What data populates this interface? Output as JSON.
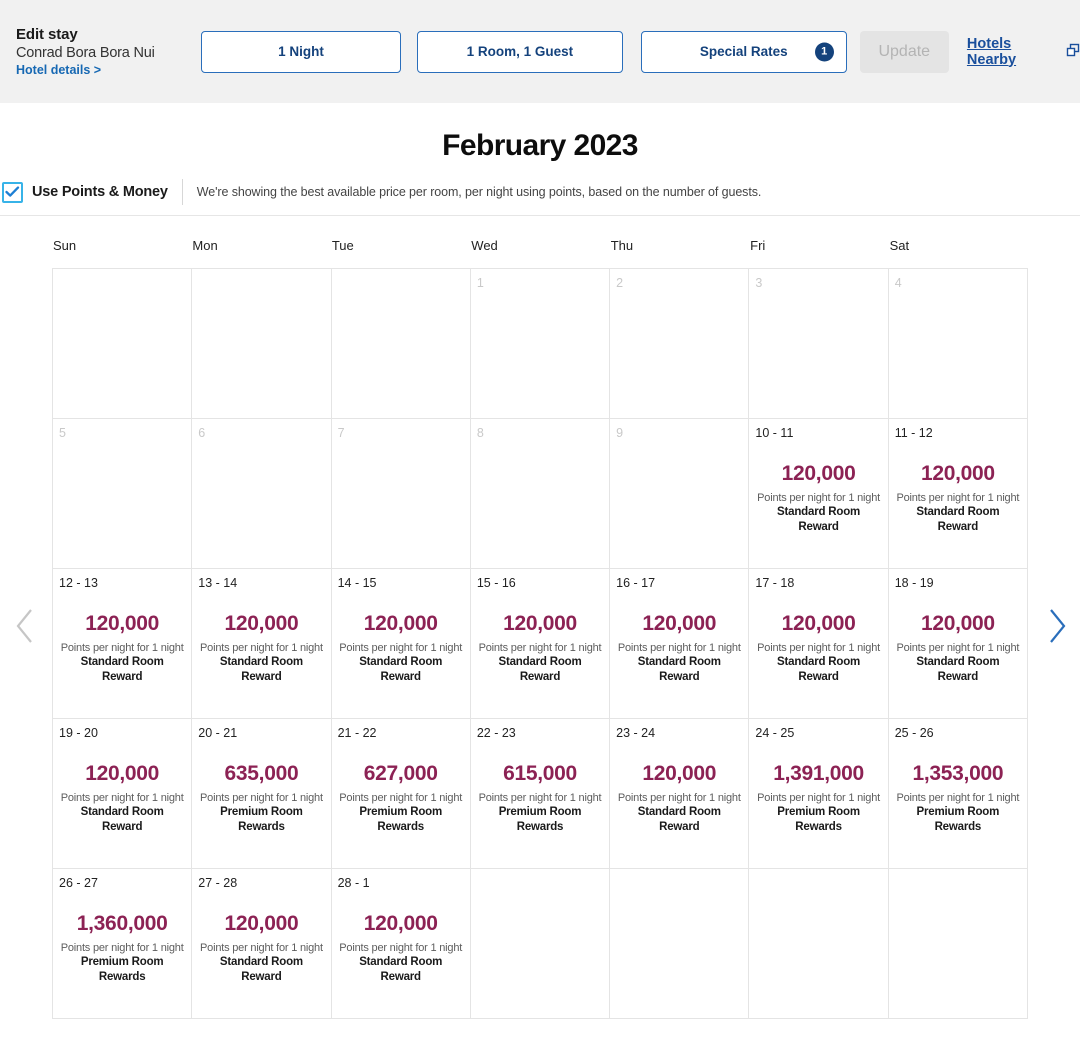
{
  "header": {
    "edit_stay_title": "Edit stay",
    "hotel_name": "Conrad Bora Bora Nui",
    "hotel_details_link": "Hotel details >",
    "nights_button": "1 Night",
    "rooms_guests_button": "1 Room, 1 Guest",
    "special_rates_button": "Special Rates",
    "special_rates_badge": "1",
    "update_button": "Update",
    "hotels_nearby_link": "Hotels Nearby",
    "external_link_icon": "external-link-icon",
    "accent_blue": "#2a6ebb",
    "badge_navy": "#14427c"
  },
  "month_title": "February 2023",
  "points_money": {
    "checkbox_checked": true,
    "checkbox_icon": "checkmark-icon",
    "label": "Use Points & Money",
    "description": "We're showing the best available price per room, per night using points, based on the number of guests.",
    "checkbox_border_color": "#37b3e8"
  },
  "calendar": {
    "prev_icon": "chevron-left-icon",
    "next_icon": "chevron-right-icon",
    "prev_enabled": false,
    "next_enabled": true,
    "points_color": "#8c2254",
    "day_headers": [
      "Sun",
      "Mon",
      "Tue",
      "Wed",
      "Thu",
      "Fri",
      "Sat"
    ],
    "cells": [
      {
        "day": "",
        "muted": true,
        "points": "",
        "sub": "",
        "room": ""
      },
      {
        "day": "",
        "muted": true,
        "points": "",
        "sub": "",
        "room": ""
      },
      {
        "day": "",
        "muted": true,
        "points": "",
        "sub": "",
        "room": ""
      },
      {
        "day": "1",
        "muted": true,
        "points": "",
        "sub": "",
        "room": ""
      },
      {
        "day": "2",
        "muted": true,
        "points": "",
        "sub": "",
        "room": ""
      },
      {
        "day": "3",
        "muted": true,
        "points": "",
        "sub": "",
        "room": ""
      },
      {
        "day": "4",
        "muted": true,
        "points": "",
        "sub": "",
        "room": ""
      },
      {
        "day": "5",
        "muted": true,
        "points": "",
        "sub": "",
        "room": ""
      },
      {
        "day": "6",
        "muted": true,
        "points": "",
        "sub": "",
        "room": ""
      },
      {
        "day": "7",
        "muted": true,
        "points": "",
        "sub": "",
        "room": ""
      },
      {
        "day": "8",
        "muted": true,
        "points": "",
        "sub": "",
        "room": ""
      },
      {
        "day": "9",
        "muted": true,
        "points": "",
        "sub": "",
        "room": ""
      },
      {
        "day": "10 - 11",
        "muted": false,
        "points": "120,000",
        "sub": "Points per night for 1 night",
        "room": "Standard Room Reward"
      },
      {
        "day": "11 - 12",
        "muted": false,
        "points": "120,000",
        "sub": "Points per night for 1 night",
        "room": "Standard Room Reward"
      },
      {
        "day": "12 - 13",
        "muted": false,
        "points": "120,000",
        "sub": "Points per night for 1 night",
        "room": "Standard Room Reward"
      },
      {
        "day": "13 - 14",
        "muted": false,
        "points": "120,000",
        "sub": "Points per night for 1 night",
        "room": "Standard Room Reward"
      },
      {
        "day": "14 - 15",
        "muted": false,
        "points": "120,000",
        "sub": "Points per night for 1 night",
        "room": "Standard Room Reward"
      },
      {
        "day": "15 - 16",
        "muted": false,
        "points": "120,000",
        "sub": "Points per night for 1 night",
        "room": "Standard Room Reward"
      },
      {
        "day": "16 - 17",
        "muted": false,
        "points": "120,000",
        "sub": "Points per night for 1 night",
        "room": "Standard Room Reward"
      },
      {
        "day": "17 - 18",
        "muted": false,
        "points": "120,000",
        "sub": "Points per night for 1 night",
        "room": "Standard Room Reward"
      },
      {
        "day": "18 - 19",
        "muted": false,
        "points": "120,000",
        "sub": "Points per night for 1 night",
        "room": "Standard Room Reward"
      },
      {
        "day": "19 - 20",
        "muted": false,
        "points": "120,000",
        "sub": "Points per night for 1 night",
        "room": "Standard Room Reward"
      },
      {
        "day": "20 - 21",
        "muted": false,
        "points": "635,000",
        "sub": "Points per night for 1 night",
        "room": "Premium Room Rewards"
      },
      {
        "day": "21 - 22",
        "muted": false,
        "points": "627,000",
        "sub": "Points per night for 1 night",
        "room": "Premium Room Rewards"
      },
      {
        "day": "22 - 23",
        "muted": false,
        "points": "615,000",
        "sub": "Points per night for 1 night",
        "room": "Premium Room Rewards"
      },
      {
        "day": "23 - 24",
        "muted": false,
        "points": "120,000",
        "sub": "Points per night for 1 night",
        "room": "Standard Room Reward"
      },
      {
        "day": "24 - 25",
        "muted": false,
        "points": "1,391,000",
        "sub": "Points per night for 1 night",
        "room": "Premium Room Rewards"
      },
      {
        "day": "25 - 26",
        "muted": false,
        "points": "1,353,000",
        "sub": "Points per night for 1 night",
        "room": "Premium Room Rewards"
      },
      {
        "day": "26 - 27",
        "muted": false,
        "points": "1,360,000",
        "sub": "Points per night for 1 night",
        "room": "Premium Room Rewards"
      },
      {
        "day": "27 - 28",
        "muted": false,
        "points": "120,000",
        "sub": "Points per night for 1 night",
        "room": "Standard Room Reward"
      },
      {
        "day": "28 - 1",
        "muted": false,
        "points": "120,000",
        "sub": "Points per night for 1 night",
        "room": "Standard Room Reward"
      },
      {
        "day": "",
        "muted": true,
        "points": "",
        "sub": "",
        "room": ""
      },
      {
        "day": "",
        "muted": true,
        "points": "",
        "sub": "",
        "room": ""
      },
      {
        "day": "",
        "muted": true,
        "points": "",
        "sub": "",
        "room": ""
      },
      {
        "day": "",
        "muted": true,
        "points": "",
        "sub": "",
        "room": ""
      }
    ]
  }
}
